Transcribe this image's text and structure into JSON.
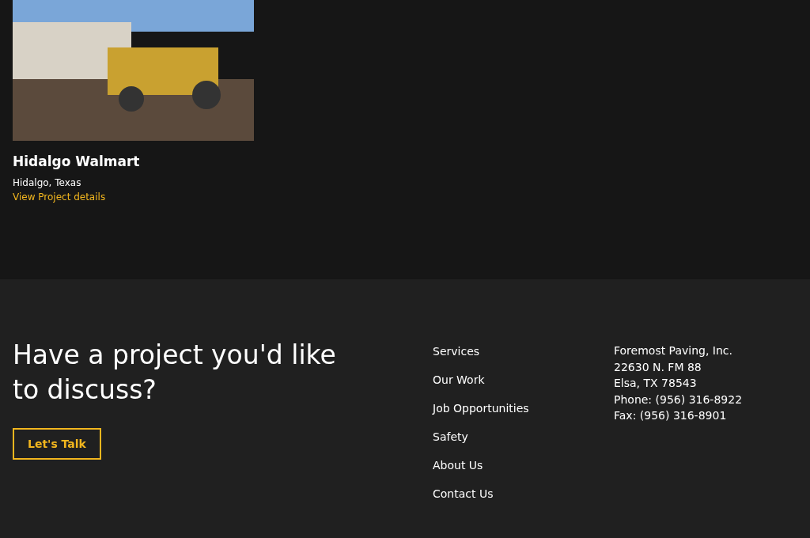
{
  "project": {
    "title": "Hidalgo Walmart",
    "location": "Hidalgo, Texas",
    "link": "View Project details"
  },
  "footer": {
    "heading": "Have a project you'd like to discuss?",
    "button": "Let's Talk",
    "nav": [
      "Services",
      "Our Work",
      "Job Opportunities",
      "Safety",
      "About Us",
      "Contact Us"
    ],
    "address": [
      "Foremost Paving, Inc.",
      "22630 N. FM 88",
      "Elsa, TX 78543",
      "Phone: (956) 316-8922",
      "Fax: (956) 316-8901"
    ]
  }
}
